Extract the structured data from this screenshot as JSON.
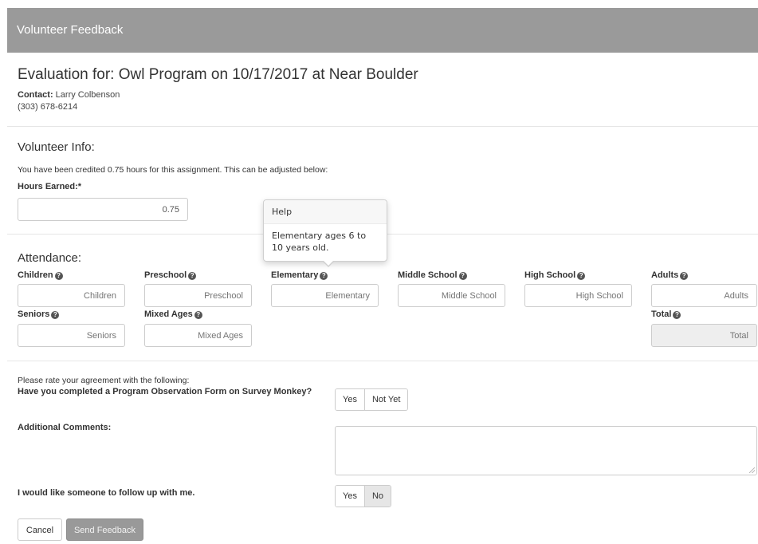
{
  "header": {
    "title": "Volunteer Feedback"
  },
  "evaluation": {
    "title": "Evaluation for: Owl Program on 10/17/2017 at Near Boulder",
    "contact_label": "Contact:",
    "contact_name": "Larry Colbenson",
    "phone": "(303) 678-6214"
  },
  "volunteer_info": {
    "title": "Volunteer Info:",
    "credit_note": "You have been credited 0.75 hours for this assignment. This can be adjusted below:",
    "hours_label": "Hours Earned:*",
    "hours_value": "0.75"
  },
  "help_popover": {
    "title": "Help",
    "body": "Elementary ages 6 to 10 years old."
  },
  "attendance": {
    "title": "Attendance:",
    "fields": [
      {
        "label": "Children",
        "placeholder": "Children"
      },
      {
        "label": "Preschool",
        "placeholder": "Preschool"
      },
      {
        "label": "Elementary",
        "placeholder": "Elementary"
      },
      {
        "label": "Middle School",
        "placeholder": "Middle School"
      },
      {
        "label": "High School",
        "placeholder": "High School"
      },
      {
        "label": "Adults",
        "placeholder": "Adults"
      },
      {
        "label": "Seniors",
        "placeholder": "Seniors"
      },
      {
        "label": "Mixed Ages",
        "placeholder": "Mixed Ages"
      },
      {
        "label": "Total",
        "placeholder": "Total"
      }
    ],
    "help_glyph": "?"
  },
  "ratings": {
    "intro": "Please rate your agreement with the following:",
    "observation_question": "Have you completed a Program Observation Form on Survey Monkey?",
    "observation_options": [
      "Yes",
      "Not Yet"
    ],
    "comments_label": "Additional Comments:",
    "followup_label": "I would like someone to follow up with me.",
    "followup_options": [
      "Yes",
      "No"
    ],
    "followup_selected": "No"
  },
  "actions": {
    "cancel_label": "Cancel",
    "send_label": "Send Feedback"
  },
  "colors": {
    "header_bg": "#9a9a9a",
    "send_button_bg": "#999999",
    "disabled_input_bg": "#eeeeee"
  },
  "icons": {
    "help": "question-circle-icon"
  }
}
